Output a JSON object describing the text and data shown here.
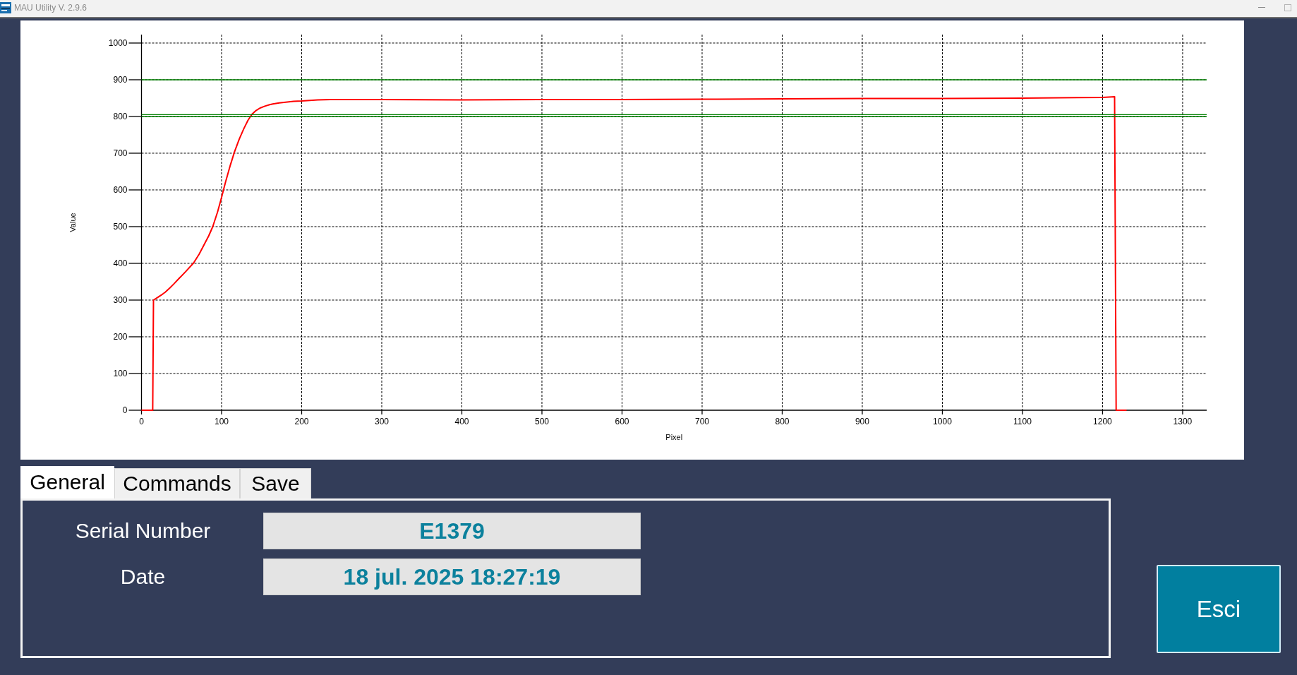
{
  "window": {
    "title": "MAU Utility V. 2.9.6"
  },
  "chart": {
    "chart_data": {
      "type": "line",
      "xlabel": "Pixel",
      "ylabel": "Value",
      "grid": true,
      "x": [
        0,
        14,
        15,
        20,
        25,
        30,
        35,
        40,
        47,
        55,
        65,
        72,
        78,
        84,
        89,
        95,
        100,
        105,
        111,
        116,
        122,
        128,
        133,
        138,
        143,
        148,
        154,
        160,
        164,
        172,
        180,
        190,
        200,
        220,
        236,
        300,
        400,
        500,
        600,
        700,
        800,
        900,
        1000,
        1100,
        1200,
        1215,
        1217,
        1230,
        1330
      ],
      "series": [
        {
          "color": "#ff0000",
          "values": [
            0,
            0,
            300,
            307,
            314,
            322,
            332,
            343,
            359,
            377,
            401,
            425,
            450,
            475,
            500,
            540,
            580,
            622,
            668,
            703,
            738,
            768,
            790,
            806,
            816,
            823,
            828,
            832,
            834,
            837,
            839,
            841,
            842,
            845,
            846,
            846,
            845,
            846,
            846,
            847,
            848,
            849,
            849,
            850,
            852,
            854,
            0,
            0,
            null
          ]
        },
        {
          "color": "#008000",
          "values": [
            900,
            900,
            900,
            900,
            900,
            900,
            900,
            900,
            900,
            900,
            900,
            900,
            900,
            900,
            900,
            900,
            900,
            900,
            900,
            900,
            900,
            900,
            900,
            900,
            900,
            900,
            900,
            900,
            900,
            900,
            900,
            900,
            900,
            900,
            900,
            900,
            900,
            900,
            900,
            900,
            900,
            900,
            900,
            900,
            900,
            900,
            900,
            900,
            900
          ]
        },
        {
          "color": "#008000",
          "values": [
            805,
            805,
            805,
            805,
            805,
            805,
            805,
            805,
            805,
            805,
            805,
            805,
            805,
            805,
            805,
            805,
            805,
            805,
            805,
            805,
            805,
            805,
            805,
            805,
            805,
            805,
            805,
            805,
            805,
            805,
            805,
            805,
            805,
            805,
            805,
            805,
            805,
            805,
            805,
            805,
            805,
            805,
            805,
            805,
            805,
            805,
            805,
            805,
            805
          ]
        },
        {
          "color": "#008000",
          "values": [
            800,
            800,
            800,
            800,
            800,
            800,
            800,
            800,
            800,
            800,
            800,
            800,
            800,
            800,
            800,
            800,
            800,
            800,
            800,
            800,
            800,
            800,
            800,
            800,
            800,
            800,
            800,
            800,
            800,
            800,
            800,
            800,
            800,
            800,
            800,
            800,
            800,
            800,
            800,
            800,
            800,
            800,
            800,
            800,
            800,
            800,
            800,
            800,
            800
          ]
        }
      ],
      "xlim": [
        0,
        1330
      ],
      "ylim": [
        0,
        1023
      ],
      "xticks": [
        0,
        100,
        200,
        300,
        400,
        500,
        600,
        700,
        800,
        900,
        1000,
        1100,
        1200,
        1300
      ],
      "yticks": [
        0,
        100,
        200,
        300,
        400,
        500,
        600,
        700,
        800,
        900,
        1000
      ]
    }
  },
  "tabs": [
    {
      "label": "General",
      "selected": true
    },
    {
      "label": "Commands",
      "selected": false
    },
    {
      "label": "Save",
      "selected": false
    }
  ],
  "general": {
    "fields": [
      {
        "label": "Serial Number",
        "value": "E1379"
      },
      {
        "label": "Date",
        "value": "18 jul. 2025 18:27:19"
      }
    ]
  },
  "exit_button": {
    "label": "Esci"
  }
}
